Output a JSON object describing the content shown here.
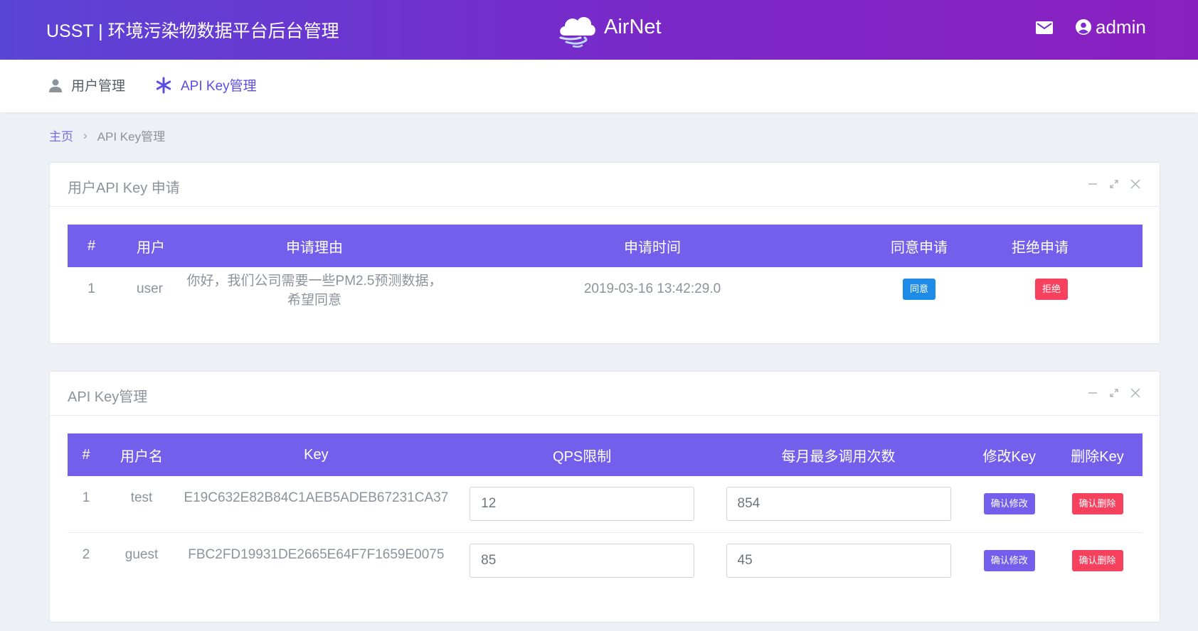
{
  "header": {
    "title": "USST | 环境污染物数据平台后台管理",
    "logo_text": "AirNet",
    "user_name": "admin"
  },
  "nav": {
    "users_label": "用户管理",
    "apikey_label": "API Key管理"
  },
  "breadcrumb": {
    "home": "主页",
    "current": "API Key管理"
  },
  "requests_panel": {
    "title": "用户API Key 申请",
    "columns": [
      "#",
      "用户",
      "申请理由",
      "申请时间",
      "同意申请",
      "拒绝申请"
    ],
    "rows": [
      {
        "index": "1",
        "user": "user",
        "reason": "你好，我们公司需要一些PM2.5预测数据，希望同意",
        "time": "2019-03-16 13:42:29.0",
        "approve_label": "同意",
        "reject_label": "拒绝"
      }
    ]
  },
  "keys_panel": {
    "title": "API Key管理",
    "columns": [
      "#",
      "用户名",
      "Key",
      "QPS限制",
      "每月最多调用次数",
      "修改Key",
      "删除Key"
    ],
    "rows": [
      {
        "index": "1",
        "username": "test",
        "key": "E19C632E82B84C1AEB5ADEB67231CA37",
        "qps": "12",
        "monthly": "854",
        "modify_label": "确认修改",
        "delete_label": "确认删除"
      },
      {
        "index": "2",
        "username": "guest",
        "key": "FBC2FD19931DE2665E64F7F1659E0075",
        "qps": "85",
        "monthly": "45",
        "modify_label": "确认修改",
        "delete_label": "确认删除"
      }
    ]
  },
  "colors": {
    "header_gradient_start": "#5a45d6",
    "header_gradient_end": "#8a1fc0",
    "table_header": "#745eec",
    "accent_blue": "#1e8be6",
    "accent_red": "#f5405e"
  },
  "icons": {
    "logo": "cloud-wind-icon",
    "mail": "mail-icon",
    "user": "user-circle-icon",
    "nav_users": "person-icon",
    "nav_apikey": "asterisk-icon",
    "panel_minimize": "minimize-icon",
    "panel_expand": "expand-icon",
    "panel_close": "close-icon"
  }
}
